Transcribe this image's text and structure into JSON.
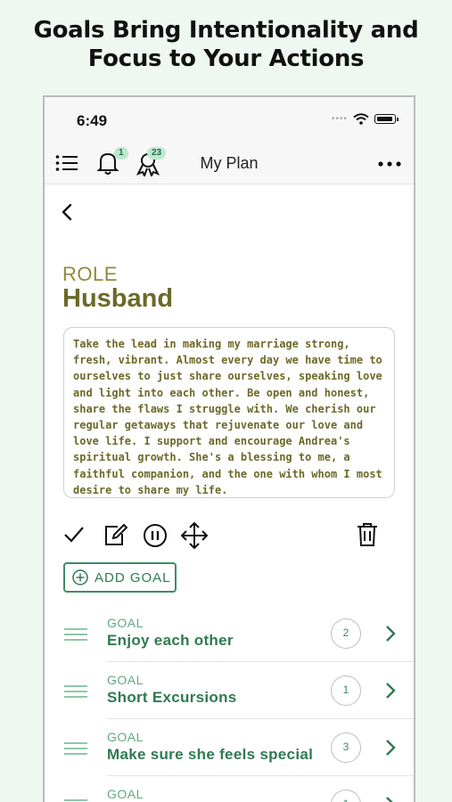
{
  "headline": "Goals Bring Intentionality and Focus to Your Actions",
  "status": {
    "time": "6:49"
  },
  "nav": {
    "title": "My Plan",
    "notifications_badge": "1",
    "awards_badge": "23"
  },
  "role": {
    "label": "ROLE",
    "name": "Husband",
    "statement": "Take the lead in making my marriage strong, fresh, vibrant. Almost every day we have time to ourselves to just share ourselves, speaking love and light into each other. Be open and honest, share the flaws I struggle with. We cherish our regular getaways that rejuvenate our love and love life. I support and encourage Andrea's spiritual growth. She's a blessing to me, a faithful companion, and the one with whom I most desire to share my life."
  },
  "add_goal_label": "ADD GOAL",
  "goals": [
    {
      "tag": "GOAL",
      "title": "Enjoy each other",
      "count": "2"
    },
    {
      "tag": "GOAL",
      "title": "Short Excursions",
      "count": "1"
    },
    {
      "tag": "GOAL",
      "title": "Make sure she feels special",
      "count": "3"
    },
    {
      "tag": "GOAL",
      "title": "",
      "count": "1"
    }
  ],
  "colors": {
    "background": "#eef8f1",
    "role_accent": "#6b6928",
    "goal_accent": "#2f7a52"
  },
  "icons": [
    "menu-icon",
    "bell-icon",
    "award-icon",
    "more-icon",
    "back-icon",
    "check-icon",
    "edit-icon",
    "pause-icon",
    "move-icon",
    "trash-icon",
    "plus-circle-icon",
    "drag-handle-icon",
    "chevron-right-icon"
  ]
}
